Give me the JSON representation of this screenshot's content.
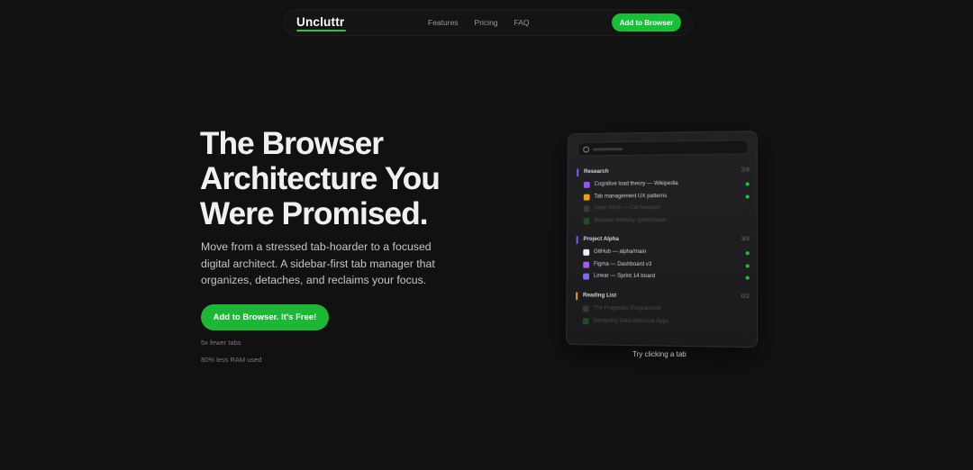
{
  "nav": {
    "logo": "Uncluttr",
    "links": [
      "Features",
      "Pricing",
      "FAQ"
    ],
    "cta": "Add to Browser"
  },
  "hero": {
    "title_line1": "The Browser",
    "title_line2": "Architecture You",
    "title_line3": "Were Promised.",
    "description": "Move from a stressed tab-hoarder to a focused digital architect. A sidebar-first tab manager that organizes, detaches, and reclaims your focus.",
    "cta": "Add to Browser. It's Free!",
    "stats": [
      "5x fewer tabs",
      "80% less RAM used"
    ]
  },
  "mockup": {
    "groups": [
      {
        "name": "Research",
        "count": "2/4",
        "accent": "#7a5cff",
        "tabs": [
          {
            "title": "Cognitive load theory — Wikipedia",
            "color": "#8a5cf6",
            "active": true
          },
          {
            "title": "Tab management UX patterns",
            "color": "#f59e0b",
            "active": true
          },
          {
            "title": "Deep Work — Cal Newport",
            "color": "#6b6b70",
            "active": false
          },
          {
            "title": "Browser memory optimization",
            "color": "#22a63a",
            "active": false
          }
        ]
      },
      {
        "name": "Project Alpha",
        "count": "3/3",
        "accent": "#7a5cff",
        "tabs": [
          {
            "title": "GitHub — alpha/main",
            "color": "#f2f2f4",
            "active": true
          },
          {
            "title": "Figma — Dashboard v3",
            "color": "#a35cf6",
            "active": true
          },
          {
            "title": "Linear — Sprint 14 board",
            "color": "#7a6cf6",
            "active": true
          }
        ]
      },
      {
        "name": "Reading List",
        "count": "0/2",
        "accent": "#f59e0b",
        "tabs": [
          {
            "title": "The Pragmatic Programmer",
            "color": "#6b6b70",
            "active": false
          },
          {
            "title": "Designing Data-Intensive Apps",
            "color": "#22a63a",
            "active": false
          }
        ]
      }
    ],
    "caption": "Try clicking a tab"
  }
}
